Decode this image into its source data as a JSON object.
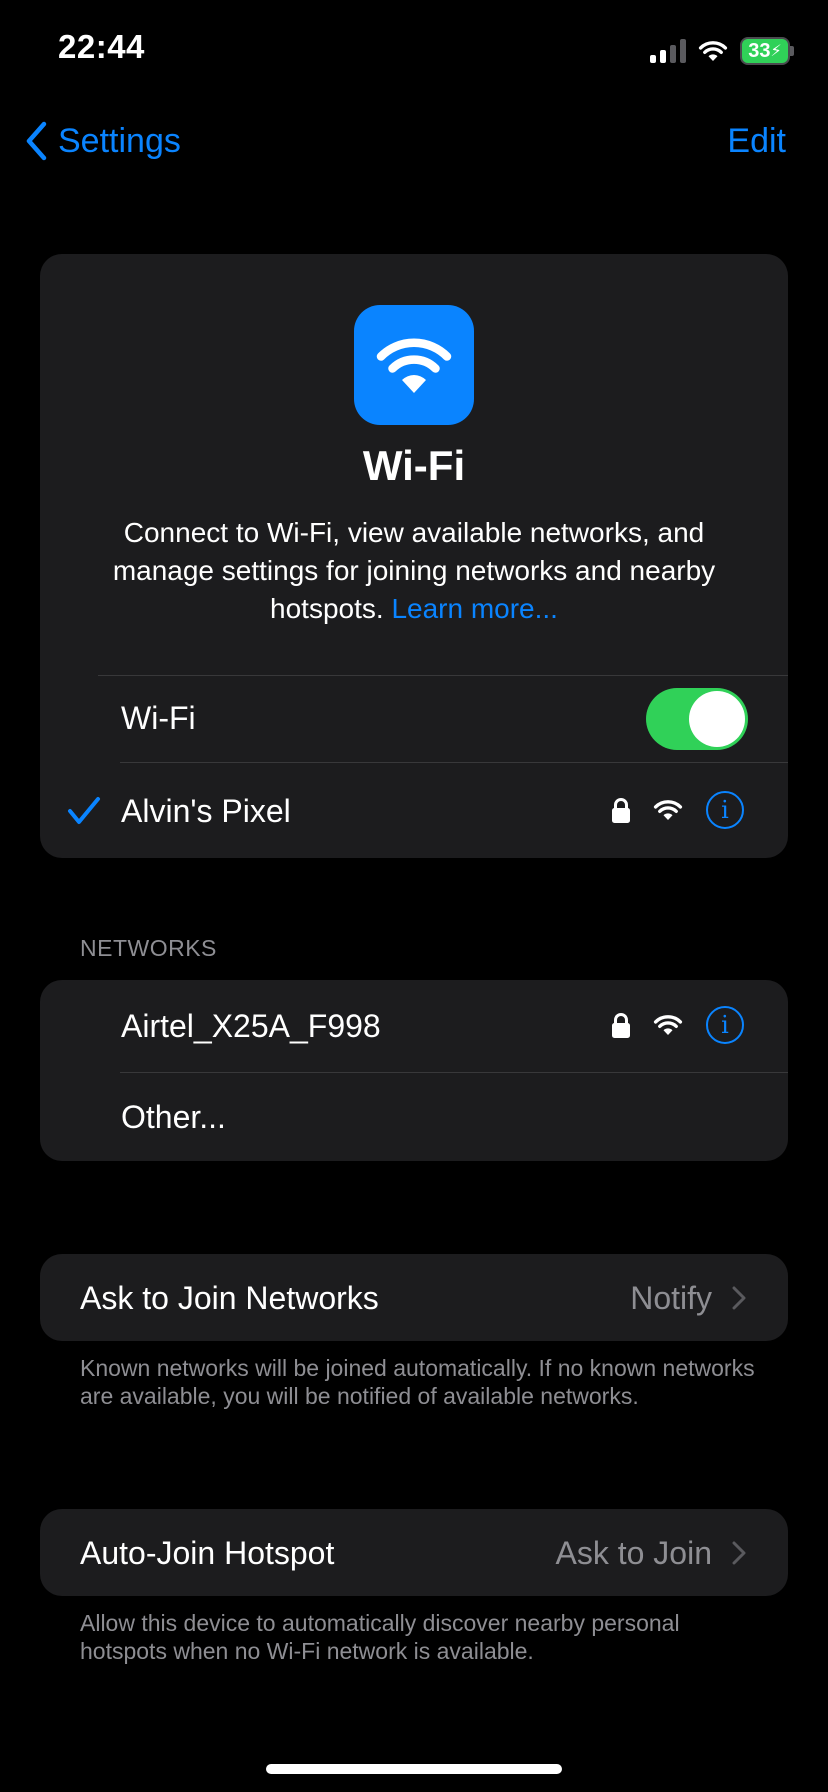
{
  "status_bar": {
    "time": "22:44",
    "battery": "33"
  },
  "nav": {
    "back_label": "Settings",
    "edit_label": "Edit"
  },
  "hero": {
    "title": "Wi-Fi",
    "description": "Connect to Wi-Fi, view available networks, and manage settings for joining networks and nearby hotspots.",
    "learn_more": "Learn more..."
  },
  "wifi_toggle": {
    "label": "Wi-Fi",
    "on": true
  },
  "connected_network": {
    "name": "Alvin's Pixel"
  },
  "networks_section": {
    "header": "NETWORKS",
    "items": [
      {
        "name": "Airtel_X25A_F998"
      }
    ],
    "other_label": "Other..."
  },
  "ask_to_join": {
    "label": "Ask to Join Networks",
    "value": "Notify",
    "footnote": "Known networks will be joined automatically. If no known networks are available, you will be notified of available networks."
  },
  "auto_join_hotspot": {
    "label": "Auto-Join Hotspot",
    "value": "Ask to Join",
    "footnote": "Allow this device to automatically discover nearby personal hotspots when no Wi-Fi network is available."
  },
  "colors": {
    "accent": "#0a84ff",
    "toggle_on": "#30d158",
    "card_bg": "#1c1c1e",
    "secondary_text": "#8e8e93"
  }
}
